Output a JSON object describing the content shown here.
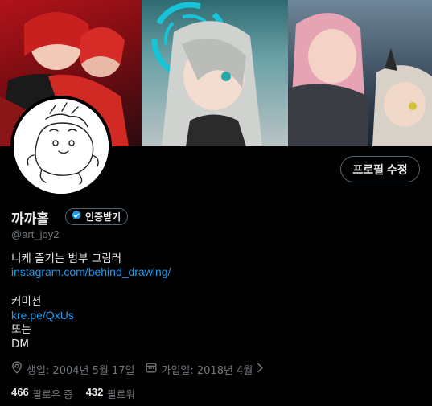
{
  "profile": {
    "display_name": "까까홀",
    "verify_label": "인증받기",
    "handle": "@art_joy2",
    "edit_profile_label": "프로필 수정",
    "bio": {
      "line1": "니케 즐기는 범부 그림러",
      "link1": "instagram.com/behind_drawing/",
      "line2": "커미션",
      "link2": "kre.pe/QxUs",
      "line3": "또는",
      "line4": "DM"
    },
    "meta": {
      "birthday": "생일: 2004년 5월 17일",
      "joined": "가입일: 2018년 4월"
    },
    "stats": {
      "following_count": "466",
      "following_label": "팔로우 중",
      "followers_count": "432",
      "followers_label": "팔로워"
    }
  },
  "icons": {
    "verified": "verified-badge-icon",
    "location": "location-pin-icon",
    "calendar": "calendar-icon",
    "chevron": "chevron-right-icon"
  },
  "colors": {
    "link": "#1d9bf0",
    "secondary_text": "#71767b",
    "primary_text": "#e7e9ea",
    "background": "#000000"
  }
}
